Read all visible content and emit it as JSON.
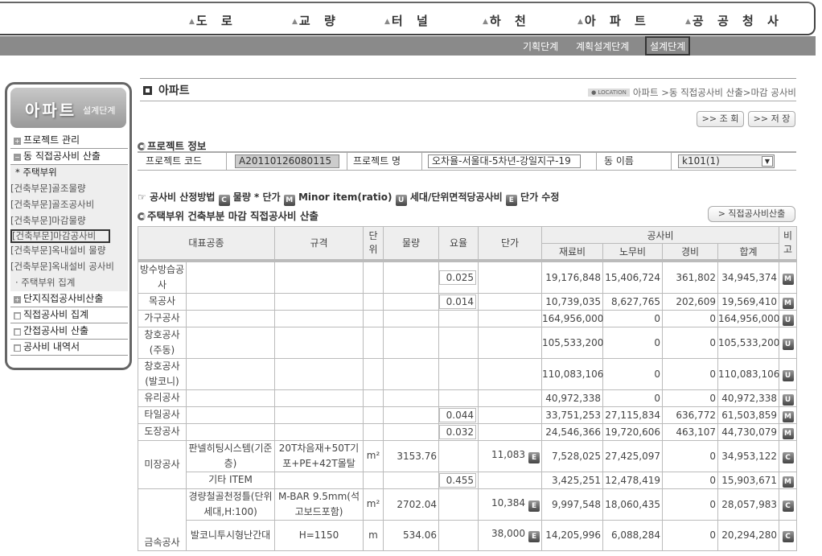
{
  "top_nav": {
    "items": [
      "도 로",
      "교 량",
      "터 널",
      "하 천",
      "아 파 트",
      "공 공 청 사"
    ],
    "stages": [
      "기획단계",
      "계획설계단계",
      "설계단계"
    ],
    "active_stage": "설계단계"
  },
  "sidebar": {
    "title": "아파트",
    "subtitle": "설계단계",
    "menu": [
      {
        "label": "프로젝트 관리",
        "icon": "plus-box-icon"
      },
      {
        "label": "동 직접공사비 산출",
        "icon": "minus-box-icon"
      }
    ],
    "submenu": [
      "* 주택부위",
      "[건축부문]골조물량",
      "[건축부문]골조공사비",
      "[건축부문]마감물량",
      "[건축부문]마감공사비",
      "[건축부문]옥내설비 물량",
      "[건축부문]옥내설비 공사비",
      "· 주택부위 집계"
    ],
    "menu_after": [
      {
        "label": "단지직접공사비산출",
        "icon": "plus-box-icon"
      },
      {
        "label": "직접공사비 집계",
        "icon": "square-icon"
      },
      {
        "label": "간접공사비 산출",
        "icon": "square-icon"
      },
      {
        "label": "공사비 내역서",
        "icon": "square-icon"
      }
    ]
  },
  "page": {
    "title": "아파트",
    "location_label": "LOCATION",
    "breadcrumb": "아파트 >동 직접공사비 산출>마감 공사비",
    "btn_search": ">> 조 회",
    "btn_save": ">> 저 장",
    "btn_calc": "> 직접공사비산출"
  },
  "project_info": {
    "section_title": "프로젝트 정보",
    "code_label": "프로젝트 코드",
    "code_value": "A20110126080115",
    "name_label": "프로젝트 명",
    "name_value": "오차율-서울대-5차년-강일지구-19",
    "dong_label": "동 이름",
    "dong_value": "k101(1)"
  },
  "legend": {
    "prefix": "공사비 산정방법",
    "c_label": "물량 * 단가",
    "m_label": "Minor item(ratio)",
    "u_label": "세대/단위면적당공사비",
    "e_label": "단가 수정"
  },
  "calc_section_title": "주택부위 건축부분 마감 직접공사비 산출",
  "table": {
    "headers": {
      "rep": "대표공종",
      "spec": "규격",
      "unit": "단위",
      "qty": "물량",
      "rate": "요율",
      "price": "단가",
      "cost": "공사비",
      "material": "재료비",
      "labor": "노무비",
      "expense": "경비",
      "total": "합계",
      "note": "비고"
    },
    "rows": [
      {
        "rep": "방수방습공사",
        "sub": "",
        "spec": "",
        "unit": "",
        "qty": "",
        "rate": "0.025",
        "price": "",
        "material": "19,176,848",
        "labor": "15,406,724",
        "expense": "361,802",
        "total": "34,945,374",
        "note": "M"
      },
      {
        "rep": "목공사",
        "sub": "",
        "spec": "",
        "unit": "",
        "qty": "",
        "rate": "0.014",
        "price": "",
        "material": "10,739,035",
        "labor": "8,627,765",
        "expense": "202,609",
        "total": "19,569,410",
        "note": "M"
      },
      {
        "rep": "가구공사",
        "sub": "",
        "spec": "",
        "unit": "",
        "qty": "",
        "rate": "",
        "price": "",
        "material": "164,956,000",
        "labor": "0",
        "expense": "0",
        "total": "164,956,000",
        "note": "U"
      },
      {
        "rep": "창호공사(주동)",
        "sub": "",
        "spec": "",
        "unit": "",
        "qty": "",
        "rate": "",
        "price": "",
        "material": "105,533,200",
        "labor": "0",
        "expense": "0",
        "total": "105,533,200",
        "note": "U"
      },
      {
        "rep": "창호공사(발코니)",
        "sub": "",
        "spec": "",
        "unit": "",
        "qty": "",
        "rate": "",
        "price": "",
        "material": "110,083,106",
        "labor": "0",
        "expense": "0",
        "total": "110,083,106",
        "note": "U"
      },
      {
        "rep": "유리공사",
        "sub": "",
        "spec": "",
        "unit": "",
        "qty": "",
        "rate": "",
        "price": "",
        "material": "40,972,338",
        "labor": "0",
        "expense": "0",
        "total": "40,972,338",
        "note": "U"
      },
      {
        "rep": "타일공사",
        "sub": "",
        "spec": "",
        "unit": "",
        "qty": "",
        "rate": "0.044",
        "price": "",
        "material": "33,751,253",
        "labor": "27,115,834",
        "expense": "636,772",
        "total": "61,503,859",
        "note": "M"
      },
      {
        "rep": "도장공사",
        "sub": "",
        "spec": "",
        "unit": "",
        "qty": "",
        "rate": "0.032",
        "price": "",
        "material": "24,546,366",
        "labor": "19,720,606",
        "expense": "463,107",
        "total": "44,730,079",
        "note": "M"
      },
      {
        "rep": "미장공사",
        "sub": "판넬히팅시스템(기준층)",
        "spec": "20T차음재+50T기포+PE+42T몰탈",
        "unit": "m²",
        "qty": "3153.76",
        "rate": "",
        "price": "11,083",
        "material": "7,528,025",
        "labor": "27,425,097",
        "expense": "0",
        "total": "34,953,122",
        "note": "C"
      },
      {
        "rep": "",
        "sub": "기타 ITEM",
        "spec": "",
        "unit": "",
        "qty": "",
        "rate": "0.455",
        "price": "",
        "material": "3,425,251",
        "labor": "12,478,419",
        "expense": "0",
        "total": "15,903,671",
        "note": "M"
      },
      {
        "rep": "금속공사",
        "sub": "경량철골천정틀(단위세대,H:100)",
        "spec": "M-BAR 9.5mm(석고보드포함)",
        "unit": "m²",
        "qty": "2702.04",
        "rate": "",
        "price": "10,384",
        "material": "9,997,548",
        "labor": "18,060,435",
        "expense": "0",
        "total": "28,057,983",
        "note": "C"
      },
      {
        "rep": "",
        "sub": "발코니투시형난간대",
        "spec": "H=1150",
        "unit": "m",
        "qty": "534.06",
        "rate": "",
        "price": "38,000",
        "material": "14,205,996",
        "labor": "6,088,284",
        "expense": "0",
        "total": "20,294,280",
        "note": "C"
      }
    ]
  },
  "colors": {
    "subbar": "#8a8a8a",
    "header_bg": "#eeeeee",
    "border": "#bbbbbb"
  }
}
